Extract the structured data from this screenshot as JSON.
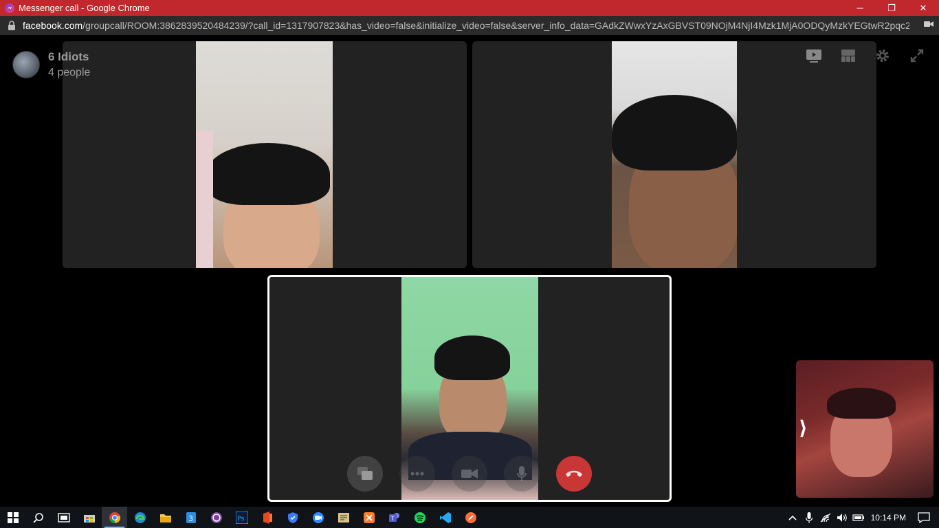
{
  "window": {
    "title": "Messenger call - Google Chrome",
    "minimize": "─",
    "restore": "❐",
    "close": "✕"
  },
  "address": {
    "domain": "facebook.com",
    "path": "/groupcall/ROOM:3862839520484239/?call_id=1317907823&has_video=false&initialize_video=false&server_info_data=GAdkZWwxYzAxGBVST09NOjM4NjI4Mzk1MjA0ODQyMzkYEGtwR2pqc2N..."
  },
  "call": {
    "group_name": "6 Idiots",
    "participant_count": "4 people",
    "top_icons": [
      "watch-together-icon",
      "grid-view-icon",
      "settings-icon",
      "fullscreen-icon"
    ],
    "controls": [
      "share-screen-icon",
      "more-icon",
      "camera-off-icon",
      "mute-icon",
      "end-call-icon"
    ],
    "selfview_toggle": "⟩"
  },
  "taskbar": {
    "apps": [
      "start",
      "search",
      "task-view",
      "store",
      "chrome",
      "edge",
      "file-explorer",
      "3d-app",
      "tor-browser",
      "photoshop",
      "office",
      "vpn",
      "zoom",
      "notes",
      "xampp",
      "teams",
      "spotify",
      "vscode",
      "postman"
    ],
    "active_app": "chrome",
    "time": "10:14 PM"
  },
  "colors": {
    "titlebar": "#c0282d",
    "end_call": "#c93636",
    "tile_bg": "#222222"
  }
}
